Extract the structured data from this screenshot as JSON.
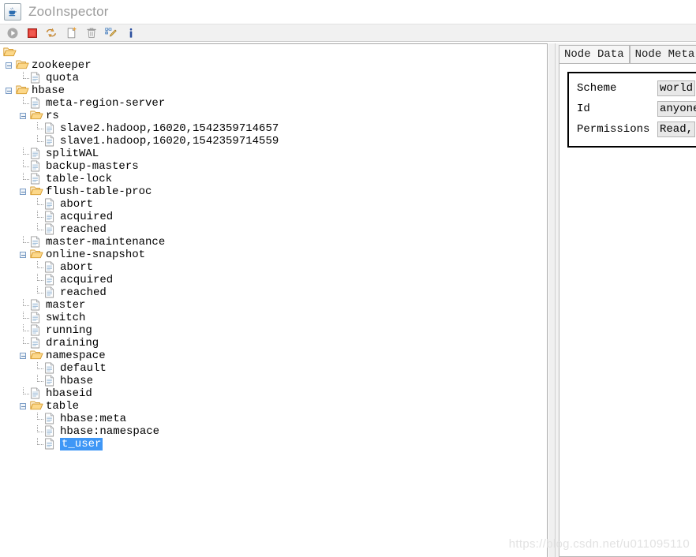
{
  "window": {
    "title": "ZooInspector",
    "icon": "java-coffee-cup-icon"
  },
  "toolbar": {
    "buttons": [
      {
        "name": "connect-button",
        "icon": "play-icon",
        "label": "Connect"
      },
      {
        "name": "disconnect-button",
        "icon": "stop-square-icon",
        "label": "Disconnect"
      },
      {
        "name": "refresh-button",
        "icon": "refresh-arrows-icon",
        "label": "Refresh"
      },
      {
        "name": "add-node-button",
        "icon": "new-document-icon",
        "label": "Add Node"
      },
      {
        "name": "delete-node-button",
        "icon": "trash-can-icon",
        "label": "Delete Node"
      },
      {
        "name": "edit-node-button",
        "icon": "edit-tree-pencil-icon",
        "label": "Edit Node"
      },
      {
        "name": "about-button",
        "icon": "info-i-icon",
        "label": "About"
      }
    ]
  },
  "tree": {
    "nodes": [
      {
        "label": "",
        "depth": 0,
        "type": "folder-open",
        "expanded": true,
        "selected": false
      },
      {
        "label": "zookeeper",
        "depth": 1,
        "type": "folder-open",
        "expanded": true,
        "selected": false
      },
      {
        "label": "quota",
        "depth": 2,
        "type": "file",
        "expanded": null,
        "selected": false
      },
      {
        "label": "hbase",
        "depth": 1,
        "type": "folder-open",
        "expanded": true,
        "selected": false
      },
      {
        "label": "meta-region-server",
        "depth": 2,
        "type": "file",
        "expanded": null,
        "selected": false
      },
      {
        "label": "rs",
        "depth": 2,
        "type": "folder-open",
        "expanded": true,
        "selected": false
      },
      {
        "label": "slave2.hadoop,16020,1542359714657",
        "depth": 3,
        "type": "file",
        "expanded": null,
        "selected": false
      },
      {
        "label": "slave1.hadoop,16020,1542359714559",
        "depth": 3,
        "type": "file",
        "expanded": null,
        "selected": false
      },
      {
        "label": "splitWAL",
        "depth": 2,
        "type": "file",
        "expanded": null,
        "selected": false
      },
      {
        "label": "backup-masters",
        "depth": 2,
        "type": "file",
        "expanded": null,
        "selected": false
      },
      {
        "label": "table-lock",
        "depth": 2,
        "type": "file",
        "expanded": null,
        "selected": false
      },
      {
        "label": "flush-table-proc",
        "depth": 2,
        "type": "folder-open",
        "expanded": true,
        "selected": false
      },
      {
        "label": "abort",
        "depth": 3,
        "type": "file",
        "expanded": null,
        "selected": false
      },
      {
        "label": "acquired",
        "depth": 3,
        "type": "file",
        "expanded": null,
        "selected": false
      },
      {
        "label": "reached",
        "depth": 3,
        "type": "file",
        "expanded": null,
        "selected": false
      },
      {
        "label": "master-maintenance",
        "depth": 2,
        "type": "file",
        "expanded": null,
        "selected": false
      },
      {
        "label": "online-snapshot",
        "depth": 2,
        "type": "folder-open",
        "expanded": true,
        "selected": false
      },
      {
        "label": "abort",
        "depth": 3,
        "type": "file",
        "expanded": null,
        "selected": false
      },
      {
        "label": "acquired",
        "depth": 3,
        "type": "file",
        "expanded": null,
        "selected": false
      },
      {
        "label": "reached",
        "depth": 3,
        "type": "file",
        "expanded": null,
        "selected": false
      },
      {
        "label": "master",
        "depth": 2,
        "type": "file",
        "expanded": null,
        "selected": false
      },
      {
        "label": "switch",
        "depth": 2,
        "type": "file",
        "expanded": null,
        "selected": false
      },
      {
        "label": "running",
        "depth": 2,
        "type": "file",
        "expanded": null,
        "selected": false
      },
      {
        "label": "draining",
        "depth": 2,
        "type": "file",
        "expanded": null,
        "selected": false
      },
      {
        "label": "namespace",
        "depth": 2,
        "type": "folder-open",
        "expanded": true,
        "selected": false
      },
      {
        "label": "default",
        "depth": 3,
        "type": "file",
        "expanded": null,
        "selected": false
      },
      {
        "label": "hbase",
        "depth": 3,
        "type": "file",
        "expanded": null,
        "selected": false
      },
      {
        "label": "hbaseid",
        "depth": 2,
        "type": "file",
        "expanded": null,
        "selected": false
      },
      {
        "label": "table",
        "depth": 2,
        "type": "folder-open",
        "expanded": true,
        "selected": false
      },
      {
        "label": "hbase:meta",
        "depth": 3,
        "type": "file",
        "expanded": null,
        "selected": false
      },
      {
        "label": "hbase:namespace",
        "depth": 3,
        "type": "file",
        "expanded": null,
        "selected": false
      },
      {
        "label": "t_user",
        "depth": 3,
        "type": "file",
        "expanded": null,
        "selected": true
      }
    ]
  },
  "right_panel": {
    "tabs": [
      {
        "label": "Node Data",
        "active": true
      },
      {
        "label": "Node Meta",
        "active": false
      }
    ],
    "acl": {
      "rows": [
        {
          "key": "Scheme",
          "value": "world"
        },
        {
          "key": "Id",
          "value": "anyone"
        },
        {
          "key": "Permissions",
          "value": "Read,"
        }
      ]
    }
  },
  "watermark": {
    "text": "https://blog.csdn.net/u011095110"
  },
  "colors": {
    "selection": "#3f97f6",
    "folder": "#e8a33d",
    "toolbar_bg": "#f1f1f1",
    "title_text": "#9b9b9b"
  }
}
